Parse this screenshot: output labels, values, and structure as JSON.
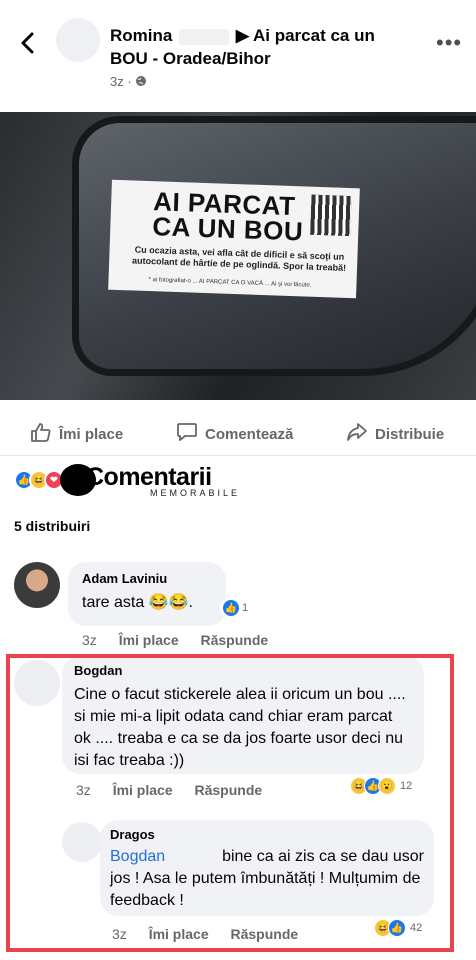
{
  "header": {
    "author": "Romina",
    "group_arrow": "▶",
    "group_title": "Ai parcat ca un BOU - Oradea/Bihor",
    "time": "3z",
    "globe_icon": "globe-icon"
  },
  "photo": {
    "sticker_title_1": "AI PARCAT",
    "sticker_title_2": "CA UN BOU",
    "sticker_body": "Cu ocazia asta, vei afla cât de dificil e să scoți un autocolant de hârtie de pe oglindă. Spor la treabă!",
    "sticker_footer": "* ai fotografiat-o ... AI PARCAT CA O VACĂ ... Ai și voi făcute."
  },
  "actions": {
    "like": "Îmi place",
    "comment": "Comentează",
    "share": "Distribuie"
  },
  "watermark": {
    "main": "Comentarii",
    "sub": "MEMORABILE"
  },
  "shares_text": "5 distribuiri",
  "comments": [
    {
      "name": "Adam Laviniu",
      "text": "tare asta 😂😂.",
      "reaction_count": "1",
      "time": "3z",
      "like": "Îmi place",
      "reply": "Răspunde"
    },
    {
      "name": "Bogdan",
      "text": "Cine o facut stickerele alea ii oricum un bou .... si mie mi-a lipit odata cand chiar eram parcat ok .... treaba e ca se da jos foarte usor deci nu isi fac treaba :))",
      "reaction_count": "12",
      "time": "3z",
      "like": "Îmi place",
      "reply": "Răspunde"
    },
    {
      "name": "Dragos",
      "mention": "Bogdan",
      "text": "bine ca ai zis ca se dau usor jos ! Asa le putem îmbunătăți ! Mulțumim de feedback !",
      "reaction_count": "42",
      "time": "3z",
      "like": "Îmi place",
      "reply": "Răspunde"
    }
  ],
  "colors": {
    "like_blue": "#1877f2",
    "haha_yellow": "#f7c63e",
    "highlight_red": "#e8434f",
    "mention_blue": "#216fdb"
  }
}
